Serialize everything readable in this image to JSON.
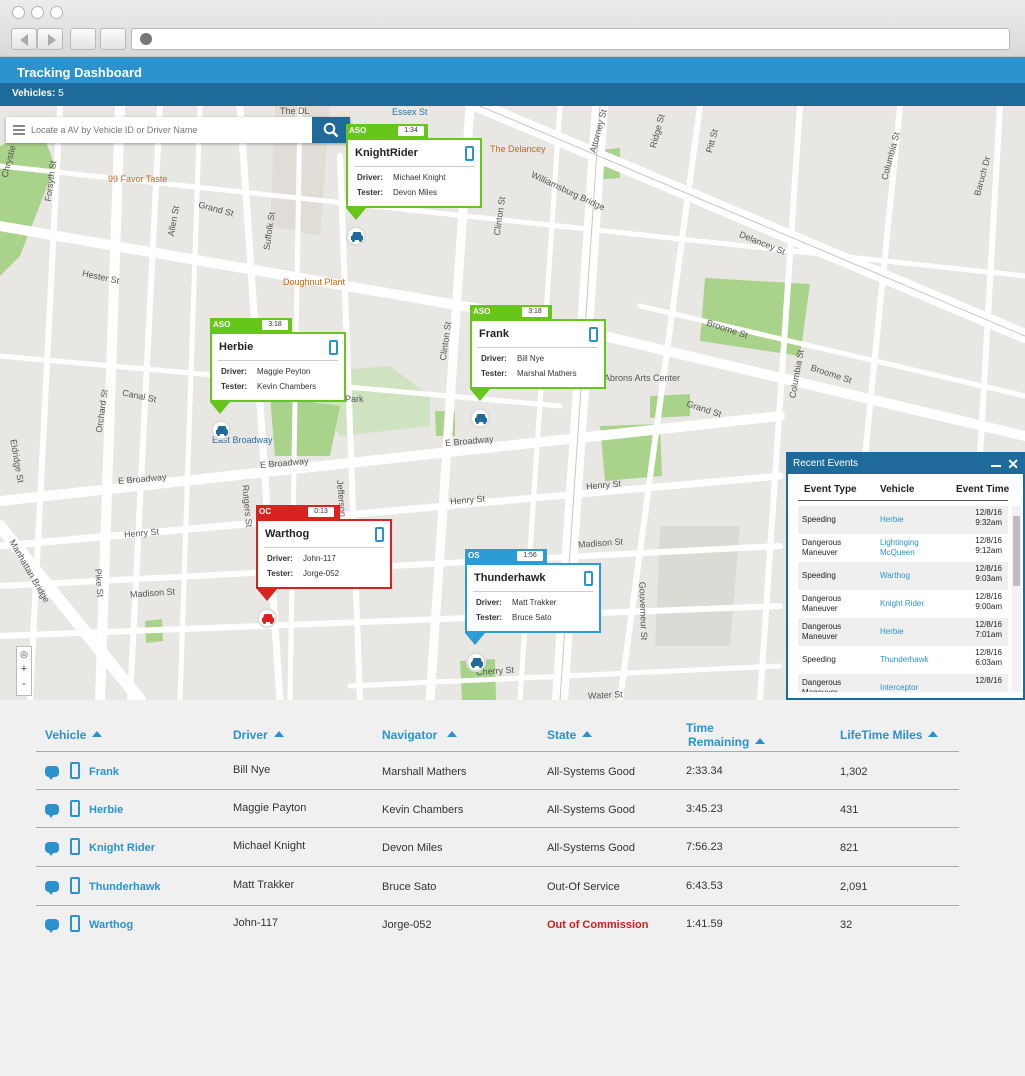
{
  "app": {
    "title": "Tracking Dashboard",
    "vehicles_label": "Vehicles:",
    "vehicles_count": "5"
  },
  "colors": {
    "header": "#2b92cd",
    "subbar": "#1e6a9a",
    "status_aso": "#66c61a",
    "status_oc": "#d9221f",
    "status_os": "#2b9cd8",
    "link": "#2b92cd",
    "alert_text": "#cc1f1f"
  },
  "search": {
    "placeholder": "Locate a AV by Vehicle ID or Driver Name",
    "icon": "search-icon"
  },
  "map": {
    "labels": [
      "Essex St",
      "The DL",
      "The Delancey",
      "99 Favor Taste",
      "Doughnut Plant",
      "Grand St",
      "Hester St",
      "Canal St",
      "Seward Park",
      "East Broadway",
      "E Broadway",
      "Henry St",
      "Madison St",
      "Rutgers St",
      "Pike St",
      "Manhattan Bridge",
      "Delancey St",
      "Broome St",
      "Williamsburg Bridge",
      "Clinton St",
      "Attorney St",
      "Ridge St",
      "Pitt St",
      "Columbia St",
      "Baruch Dr",
      "Grand St",
      "Henry St",
      "Madison St",
      "Water St",
      "Cherry St",
      "Gouverneur St",
      "Allen St",
      "Forsyth St",
      "Chrystie St",
      "Eldridge St",
      "Jefferson St",
      "Clinton St",
      "Abrons Arts Center",
      "Orchard St",
      "Suffolk St",
      "Broome St",
      "Columbia St"
    ],
    "zoom_controls": [
      "+",
      "-"
    ]
  },
  "vehicles_on_map": [
    {
      "name": "KnightRider",
      "status": "ASO",
      "time": "1:34",
      "driver": "Michael Knight",
      "tester": "Devon Miles"
    },
    {
      "name": "Herbie",
      "status": "ASO",
      "time": "3:18",
      "driver": "Maggie Peyton",
      "tester": "Kevin Chambers"
    },
    {
      "name": "Frank",
      "status": "ASO",
      "time": "3:18",
      "driver": "Bill Nye",
      "tester": "Marshal Mathers"
    },
    {
      "name": "Warthog",
      "status": "OC",
      "time": "0:13",
      "driver": "John-117",
      "tester": "Jorge-052"
    },
    {
      "name": "Thunderhawk",
      "status": "OS",
      "time": "1:56",
      "driver": "Matt Trakker",
      "tester": "Bruce Sato"
    }
  ],
  "callout_labels": {
    "driver": "Driver:",
    "tester": "Tester:"
  },
  "recent_events": {
    "title": "Recent Events",
    "columns": [
      "Event Type",
      "Vehicle",
      "Event Time"
    ],
    "rows": [
      {
        "type": "Speeding",
        "vehicle": "Herbie",
        "date": "12/8/16",
        "time": "9:32am"
      },
      {
        "type": "Dangerous Maneuver",
        "vehicle": "Lightinging McQueen",
        "date": "12/8/16",
        "time": "9:12am"
      },
      {
        "type": "Speeding",
        "vehicle": "Warthog",
        "date": "12/8/16",
        "time": "9:03am"
      },
      {
        "type": "Dangerous Maneuver",
        "vehicle": "Knight Rider",
        "date": "12/8/16",
        "time": "9:00am"
      },
      {
        "type": "Dangerous Maneuver",
        "vehicle": "Herbie",
        "date": "12/8/16",
        "time": "7:01am"
      },
      {
        "type": "Speeding",
        "vehicle": "Thunderhawk",
        "date": "12/8/16",
        "time": "6:03am"
      },
      {
        "type": "Dangerous Maneuver",
        "vehicle": "Interceptor",
        "date": "12/8/16",
        "time": ""
      }
    ]
  },
  "table": {
    "headers": {
      "vehicle": "Vehicle",
      "driver": "Driver",
      "navigator": "Navigator",
      "state": "State",
      "time_remaining_1": "Time",
      "time_remaining_2": "Remaining",
      "lifetime_miles": "LifeTime Miles"
    },
    "rows": [
      {
        "vehicle": "Frank",
        "driver": "Bill Nye",
        "navigator": "Marshall Mathers",
        "state": "All-Systems Good",
        "time_remaining": "2:33.34",
        "miles": "1,302",
        "alert": false
      },
      {
        "vehicle": "Herbie",
        "driver": "Maggie Payton",
        "navigator": "Kevin Chambers",
        "state": "All-Systems Good",
        "time_remaining": "3:45.23",
        "miles": "431",
        "alert": false
      },
      {
        "vehicle": "Knight Rider",
        "driver": "Michael Knight",
        "navigator": "Devon Miles",
        "state": "All-Systems Good",
        "time_remaining": "7:56.23",
        "miles": "821",
        "alert": false
      },
      {
        "vehicle": "Thunderhawk",
        "driver": "Matt Trakker",
        "navigator": "Bruce Sato",
        "state": "Out-Of Service",
        "time_remaining": "6:43.53",
        "miles": "2,091",
        "alert": false
      },
      {
        "vehicle": "Warthog",
        "driver": "John-117",
        "navigator": "Jorge-052",
        "state": "Out of Commission",
        "time_remaining": "1:41.59",
        "miles": "32",
        "alert": true
      }
    ]
  }
}
